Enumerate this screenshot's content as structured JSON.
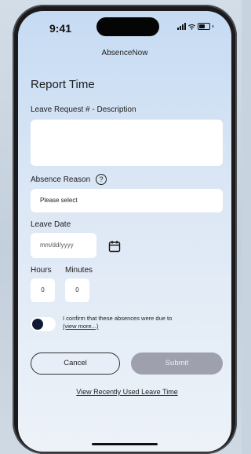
{
  "status_bar": {
    "time": "9:41"
  },
  "app": {
    "title": "AbsenceNow"
  },
  "form": {
    "heading": "Report Time",
    "leave_request_label": "Leave Request # - Description",
    "leave_request_value": "",
    "absence_reason_label": "Absence Reason",
    "help_symbol": "?",
    "absence_reason_value": "Please select",
    "leave_date_label": "Leave Date",
    "leave_date_placeholder": "mm/dd/yyyy",
    "hours_label": "Hours",
    "hours_value": "0",
    "minutes_label": "Minutes",
    "minutes_value": "0",
    "confirm_text": "I confirm that these absences were due to",
    "view_more": "(view more...)",
    "confirm_toggle_on": false,
    "cancel_label": "Cancel",
    "submit_label": "Submit",
    "recent_link": "View Recently Used Leave Time"
  },
  "colors": {
    "submit_disabled": "#9ea0ae",
    "toggle_knob": "#131a36",
    "screen_top": "#c6dbf3"
  },
  "icons": {
    "help": "question-circle-icon",
    "calendar": "calendar-icon",
    "signal": "cellular-signal-icon",
    "wifi": "wifi-icon",
    "battery": "battery-icon"
  }
}
